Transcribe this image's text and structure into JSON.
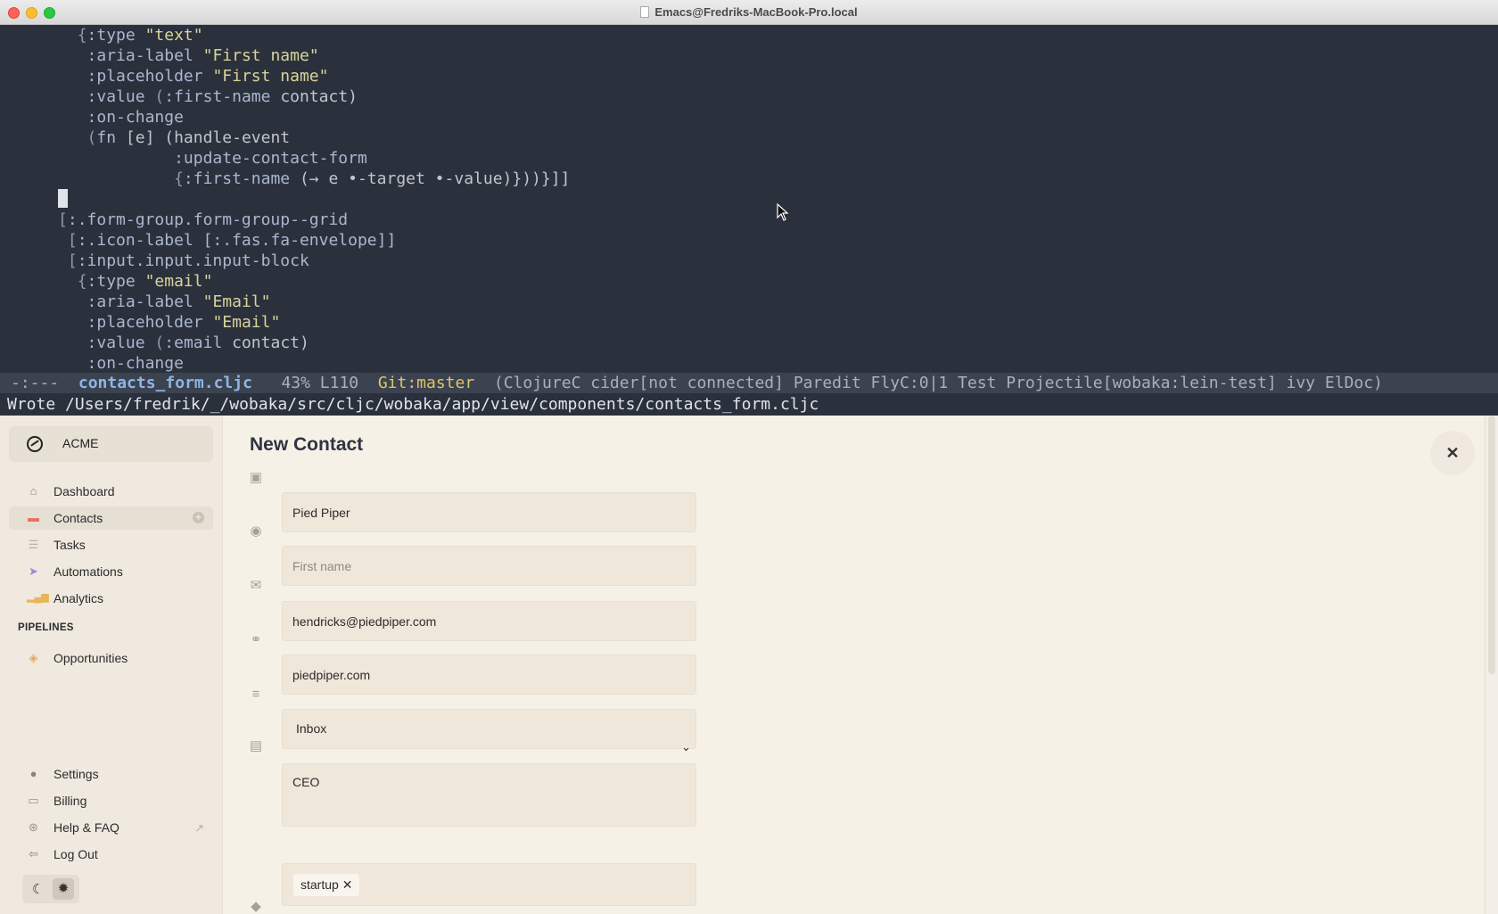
{
  "window": {
    "title": "Emacs@Fredriks-MacBook-Pro.local"
  },
  "editor": {
    "lines": [
      [
        {
          "t": "        {",
          "c": "br"
        },
        {
          "t": ":type",
          "c": "kw"
        },
        {
          "t": " ",
          "c": "sy"
        },
        {
          "t": "\"text\"",
          "c": "st"
        }
      ],
      [
        {
          "t": "         ",
          "c": "sy"
        },
        {
          "t": ":aria-label",
          "c": "kw"
        },
        {
          "t": " ",
          "c": "sy"
        },
        {
          "t": "\"First name\"",
          "c": "st"
        }
      ],
      [
        {
          "t": "         ",
          "c": "sy"
        },
        {
          "t": ":placeholder",
          "c": "kw"
        },
        {
          "t": " ",
          "c": "sy"
        },
        {
          "t": "\"First name\"",
          "c": "st"
        }
      ],
      [
        {
          "t": "         ",
          "c": "sy"
        },
        {
          "t": ":value",
          "c": "kw"
        },
        {
          "t": " (",
          "c": "br"
        },
        {
          "t": ":first-name",
          "c": "kw"
        },
        {
          "t": " contact)",
          "c": "sy"
        }
      ],
      [
        {
          "t": "         ",
          "c": "sy"
        },
        {
          "t": ":on-change",
          "c": "kw"
        }
      ],
      [
        {
          "t": "         (",
          "c": "br"
        },
        {
          "t": "fn",
          "c": "kw"
        },
        {
          "t": " [e] (handle-event",
          "c": "sy"
        }
      ],
      [
        {
          "t": "                  ",
          "c": "sy"
        },
        {
          "t": ":update-contact-form",
          "c": "kw"
        }
      ],
      [
        {
          "t": "                  {",
          "c": "br"
        },
        {
          "t": ":first-name",
          "c": "kw"
        },
        {
          "t": " (→ e •-target •-value)}))}]]",
          "c": "sy"
        }
      ],
      [
        {
          "t": "      ",
          "c": "sy"
        },
        {
          "t": "",
          "c": "cursor"
        }
      ],
      [
        {
          "t": "      [",
          "c": "br"
        },
        {
          "t": ":.form-group.form-group--grid",
          "c": "kw"
        }
      ],
      [
        {
          "t": "       [",
          "c": "br"
        },
        {
          "t": ":.icon-label [:.fas.fa-envelope]]",
          "c": "kw"
        }
      ],
      [
        {
          "t": "       [",
          "c": "br"
        },
        {
          "t": ":input.input.input-block",
          "c": "kw"
        }
      ],
      [
        {
          "t": "        {",
          "c": "br"
        },
        {
          "t": ":type",
          "c": "kw"
        },
        {
          "t": " ",
          "c": "sy"
        },
        {
          "t": "\"email\"",
          "c": "st"
        }
      ],
      [
        {
          "t": "         ",
          "c": "sy"
        },
        {
          "t": ":aria-label",
          "c": "kw"
        },
        {
          "t": " ",
          "c": "sy"
        },
        {
          "t": "\"Email\"",
          "c": "st"
        }
      ],
      [
        {
          "t": "         ",
          "c": "sy"
        },
        {
          "t": ":placeholder",
          "c": "kw"
        },
        {
          "t": " ",
          "c": "sy"
        },
        {
          "t": "\"Email\"",
          "c": "st"
        }
      ],
      [
        {
          "t": "         ",
          "c": "sy"
        },
        {
          "t": ":value",
          "c": "kw"
        },
        {
          "t": " (",
          "c": "br"
        },
        {
          "t": ":email",
          "c": "kw"
        },
        {
          "t": " contact)",
          "c": "sy"
        }
      ],
      [
        {
          "t": "         ",
          "c": "sy"
        },
        {
          "t": ":on-change",
          "c": "kw"
        }
      ]
    ],
    "modeline": {
      "prefix": "-:---  ",
      "file": "contacts_form.cljc",
      "position": "   43% L110  ",
      "git": "Git:master",
      "modes": "  (ClojureC cider[not connected] Paredit FlyC:0|1 Test Projectile[wobaka:lein-test] ivy ElDoc)"
    },
    "echo": "Wrote /Users/fredrik/_/wobaka/src/cljc/wobaka/app/view/components/contacts_form.cljc"
  },
  "sidebar": {
    "brand": "ACME",
    "nav": [
      {
        "label": "Dashboard",
        "icon": "home-icon"
      },
      {
        "label": "Contacts",
        "icon": "contacts-icon"
      },
      {
        "label": "Tasks",
        "icon": "tasks-icon"
      },
      {
        "label": "Automations",
        "icon": "paper-plane-icon"
      },
      {
        "label": "Analytics",
        "icon": "chart-icon"
      }
    ],
    "pipelines_heading": "PIPELINES",
    "pipelines": [
      {
        "label": "Opportunities",
        "icon": "layers-icon"
      }
    ],
    "footer": [
      {
        "label": "Settings",
        "icon": "user-settings-icon"
      },
      {
        "label": "Billing",
        "icon": "credit-card-icon"
      },
      {
        "label": "Help & FAQ",
        "icon": "help-icon"
      },
      {
        "label": "Log Out",
        "icon": "logout-icon"
      }
    ]
  },
  "form": {
    "title": "New Contact",
    "company": {
      "value": "Pied Piper"
    },
    "first_name": {
      "value": "",
      "placeholder": "First name"
    },
    "email": {
      "value": "hendricks@piedpiper.com"
    },
    "website": {
      "value": "piedpiper.com"
    },
    "list": {
      "selected": "Inbox"
    },
    "title_field": {
      "value": "CEO"
    },
    "tags": [
      "startup ✕"
    ]
  },
  "colors": {
    "editor_bg": "#2b313c",
    "app_bg": "#f6f1e7",
    "contacts_icon": "#e8735f",
    "automations_icon": "#9b8ad9",
    "analytics_icon": "#e7b65a",
    "opportunities_icon": "#e7a85a"
  }
}
